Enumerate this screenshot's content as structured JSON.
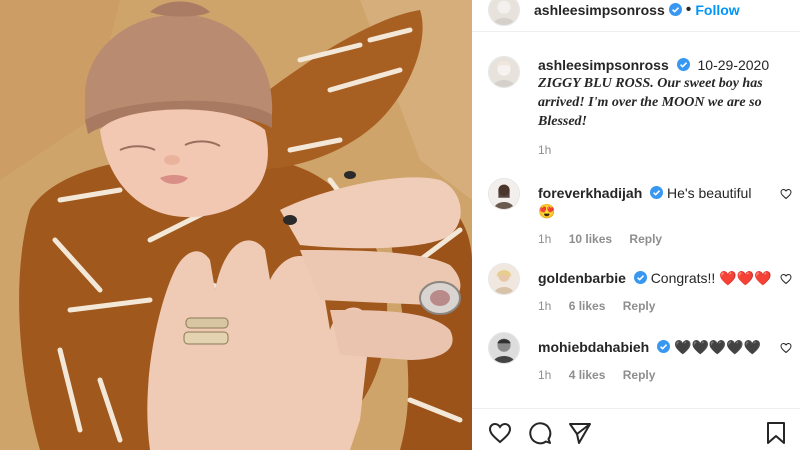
{
  "post": {
    "username": "ashleesimpsonross",
    "follow_label": "Follow",
    "dot": "•"
  },
  "caption": {
    "username": "ashleesimpsonross",
    "date": "10-29-2020",
    "text": "ZIGGY BLU ROSS. Our sweet boy has arrived! I'm over the MOON we are so Blessed!",
    "time": "1h"
  },
  "comments": [
    {
      "username": "foreverkhadijah",
      "text": "He's beautiful",
      "emoji": "😍",
      "time": "1h",
      "likes": "10 likes",
      "reply": "Reply"
    },
    {
      "username": "goldenbarbie",
      "text": "Congrats!!",
      "emoji": "❤️❤️❤️",
      "time": "1h",
      "likes": "6 likes",
      "reply": "Reply"
    },
    {
      "username": "mohiebdahabieh",
      "text": "",
      "emoji": "🖤🖤🖤🖤🖤",
      "time": "1h",
      "likes": "4 likes",
      "reply": "Reply"
    }
  ],
  "colors": {
    "link_blue": "#0095f6",
    "verified_blue": "#3897f0",
    "muted_gray": "#8e8e8e"
  },
  "icons": [
    "verified-badge-icon",
    "heart-icon",
    "comment-icon",
    "share-icon",
    "bookmark-icon"
  ]
}
